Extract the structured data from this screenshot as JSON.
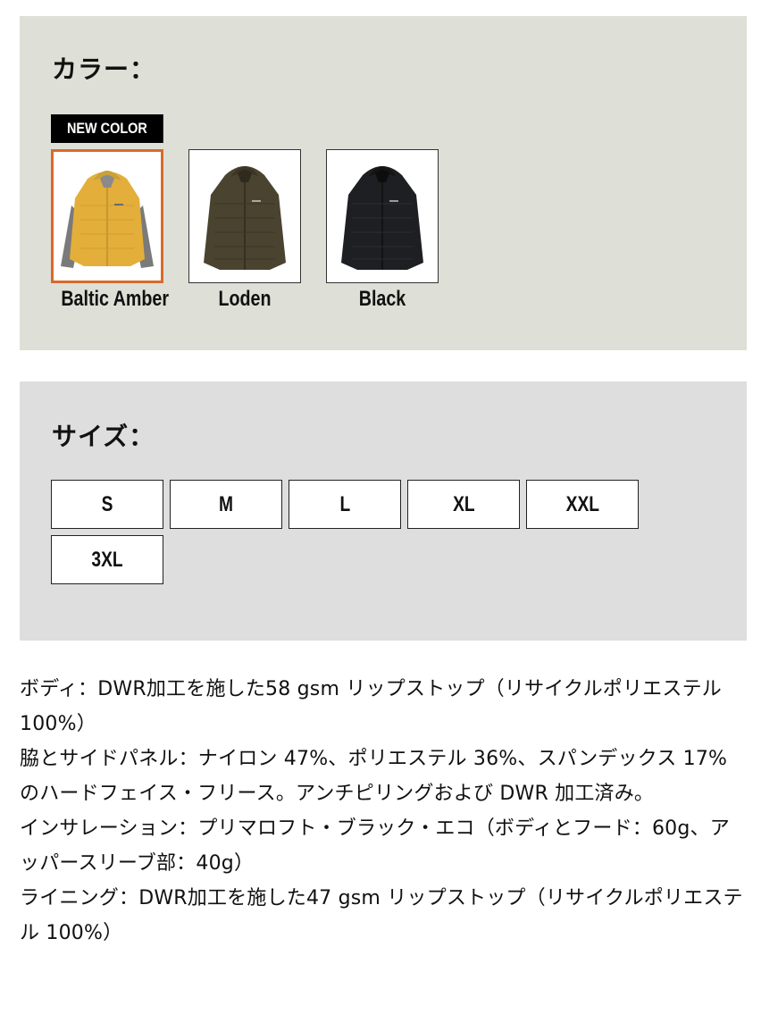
{
  "color_section": {
    "title": "カラー：",
    "badge": "NEW COLOR",
    "swatches": [
      {
        "label": "Baltic Amber",
        "color": "#e4ae3a",
        "accent": "#7a7a7a",
        "selected": true
      },
      {
        "label": "Loden",
        "color": "#4a4330",
        "accent": "#3c3626",
        "selected": false
      },
      {
        "label": "Black",
        "color": "#1e1f22",
        "accent": "#151515",
        "selected": false
      }
    ],
    "selected_border_color": "#d9692c"
  },
  "size_section": {
    "title": "サイズ：",
    "sizes": [
      "S",
      "M",
      "L",
      "XL",
      "XXL",
      "3XL"
    ]
  },
  "specs": [
    "ボディ：DWR加工を施した58 gsm リップストップ（リサイクルポリエステル 100%）",
    "脇とサイドパネル：ナイロン 47%、ポリエステル 36%、スパンデックス 17% のハードフェイス・フリース。アンチピリングおよび DWR 加工済み。",
    "インサレーション：プリマロフト・ブラック・エコ（ボディとフード：60g、アッパースリーブ部：40g）",
    "ライニング：DWR加工を施した47 gsm リップストップ（リサイクルポリエステル 100%）"
  ],
  "colors": {
    "color_panel_bg": "#dedfd6",
    "size_panel_bg": "#dedede"
  }
}
